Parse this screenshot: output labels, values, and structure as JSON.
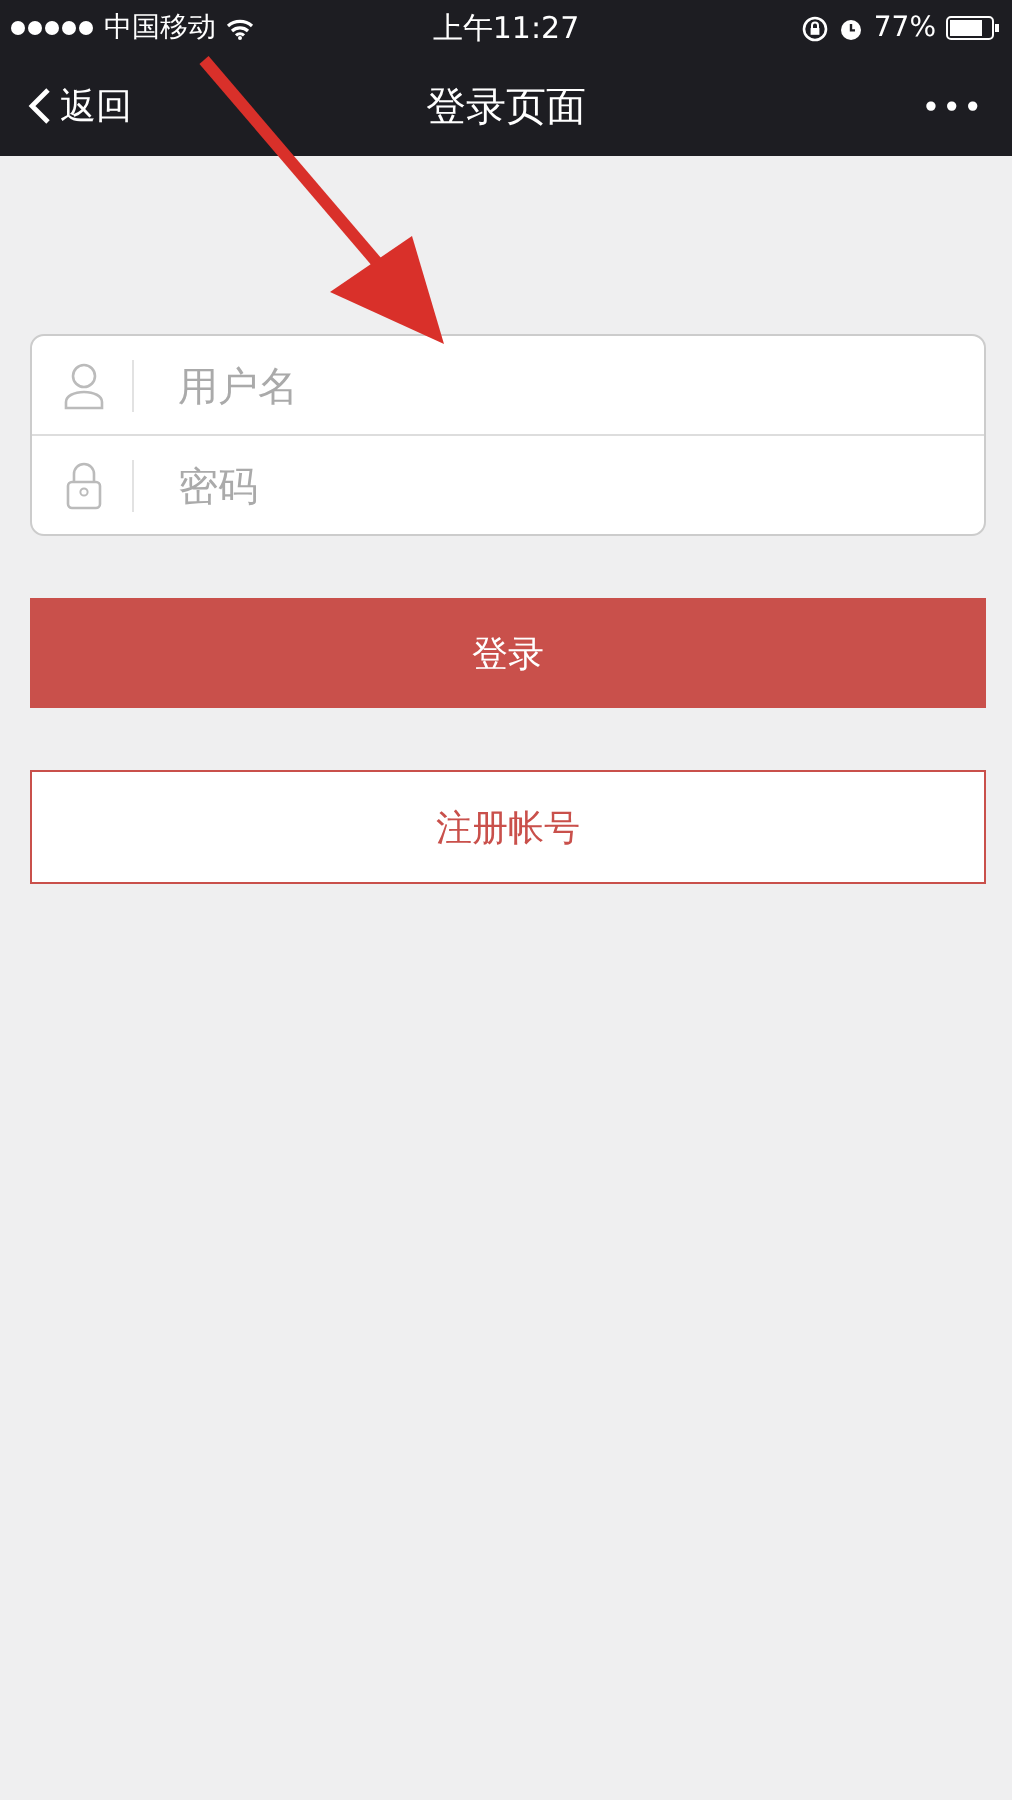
{
  "status_bar": {
    "carrier": "中国移动",
    "time": "上午11:27",
    "battery": "77%"
  },
  "nav_bar": {
    "back": "返回",
    "title": "登录页面",
    "more": "•••"
  },
  "fields": [
    {
      "kind": "user",
      "placeholder": "用户名"
    },
    {
      "kind": "lock",
      "placeholder": "密码"
    }
  ],
  "login_button": "登录",
  "register_button": "注册帐号"
}
